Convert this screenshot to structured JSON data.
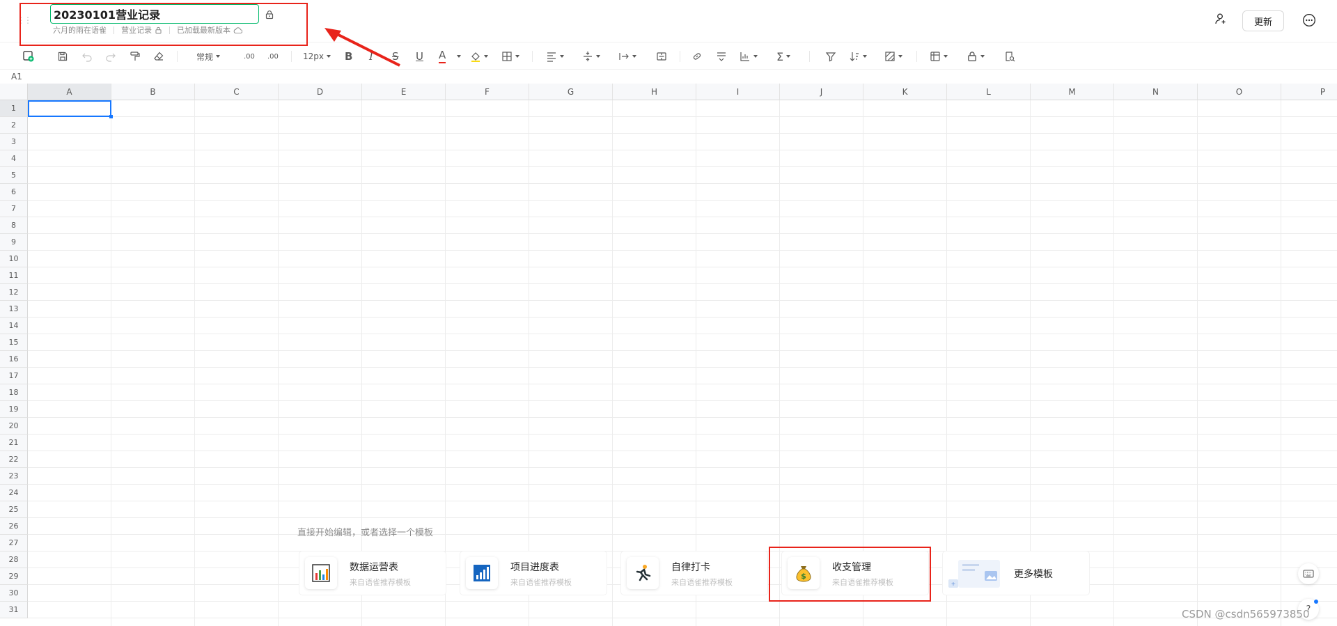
{
  "header": {
    "title": "20230101营业记录",
    "meta": {
      "owner": "六月的雨在语雀",
      "book": "营业记录",
      "status": "已加载最新版本"
    },
    "update_label": "更新"
  },
  "toolbar": {
    "format_label": "常规",
    "decimal_dec": ".00",
    "decimal_inc": ".00",
    "font_size": "12px",
    "bold": "B",
    "italic": "I",
    "strike": "S",
    "underline": "U",
    "font_color": "A",
    "sum": "Σ"
  },
  "cell_ref": "A1",
  "columns": [
    "A",
    "B",
    "C",
    "D",
    "E",
    "F",
    "G",
    "H",
    "I",
    "J",
    "K",
    "L",
    "M",
    "N",
    "O",
    "P"
  ],
  "rows": [
    "1",
    "2",
    "3",
    "4",
    "5",
    "6",
    "7",
    "8",
    "9",
    "10",
    "11",
    "12",
    "13",
    "14",
    "15",
    "16",
    "17",
    "18",
    "19",
    "20",
    "21",
    "22",
    "23",
    "24",
    "25",
    "26",
    "27",
    "28",
    "29",
    "30",
    "31"
  ],
  "templates": {
    "hint": "直接开始编辑，或者选择一个模板",
    "items": [
      {
        "name": "数据运营表",
        "sub": "来自语雀推荐模板",
        "icon": "bar-chart-icon"
      },
      {
        "name": "项目进度表",
        "sub": "来自语雀推荐模板",
        "icon": "progress-chart-icon"
      },
      {
        "name": "自律打卡",
        "sub": "来自语雀推荐模板",
        "icon": "running-person-icon"
      },
      {
        "name": "收支管理",
        "sub": "来自语雀推荐模板",
        "icon": "money-bag-icon"
      }
    ],
    "more_label": "更多模板"
  },
  "help_label": "?",
  "watermark": "CSDN @csdn565973850",
  "colors": {
    "accent": "#00b96b",
    "selection": "#1677ff",
    "annotation": "#e8231a"
  }
}
